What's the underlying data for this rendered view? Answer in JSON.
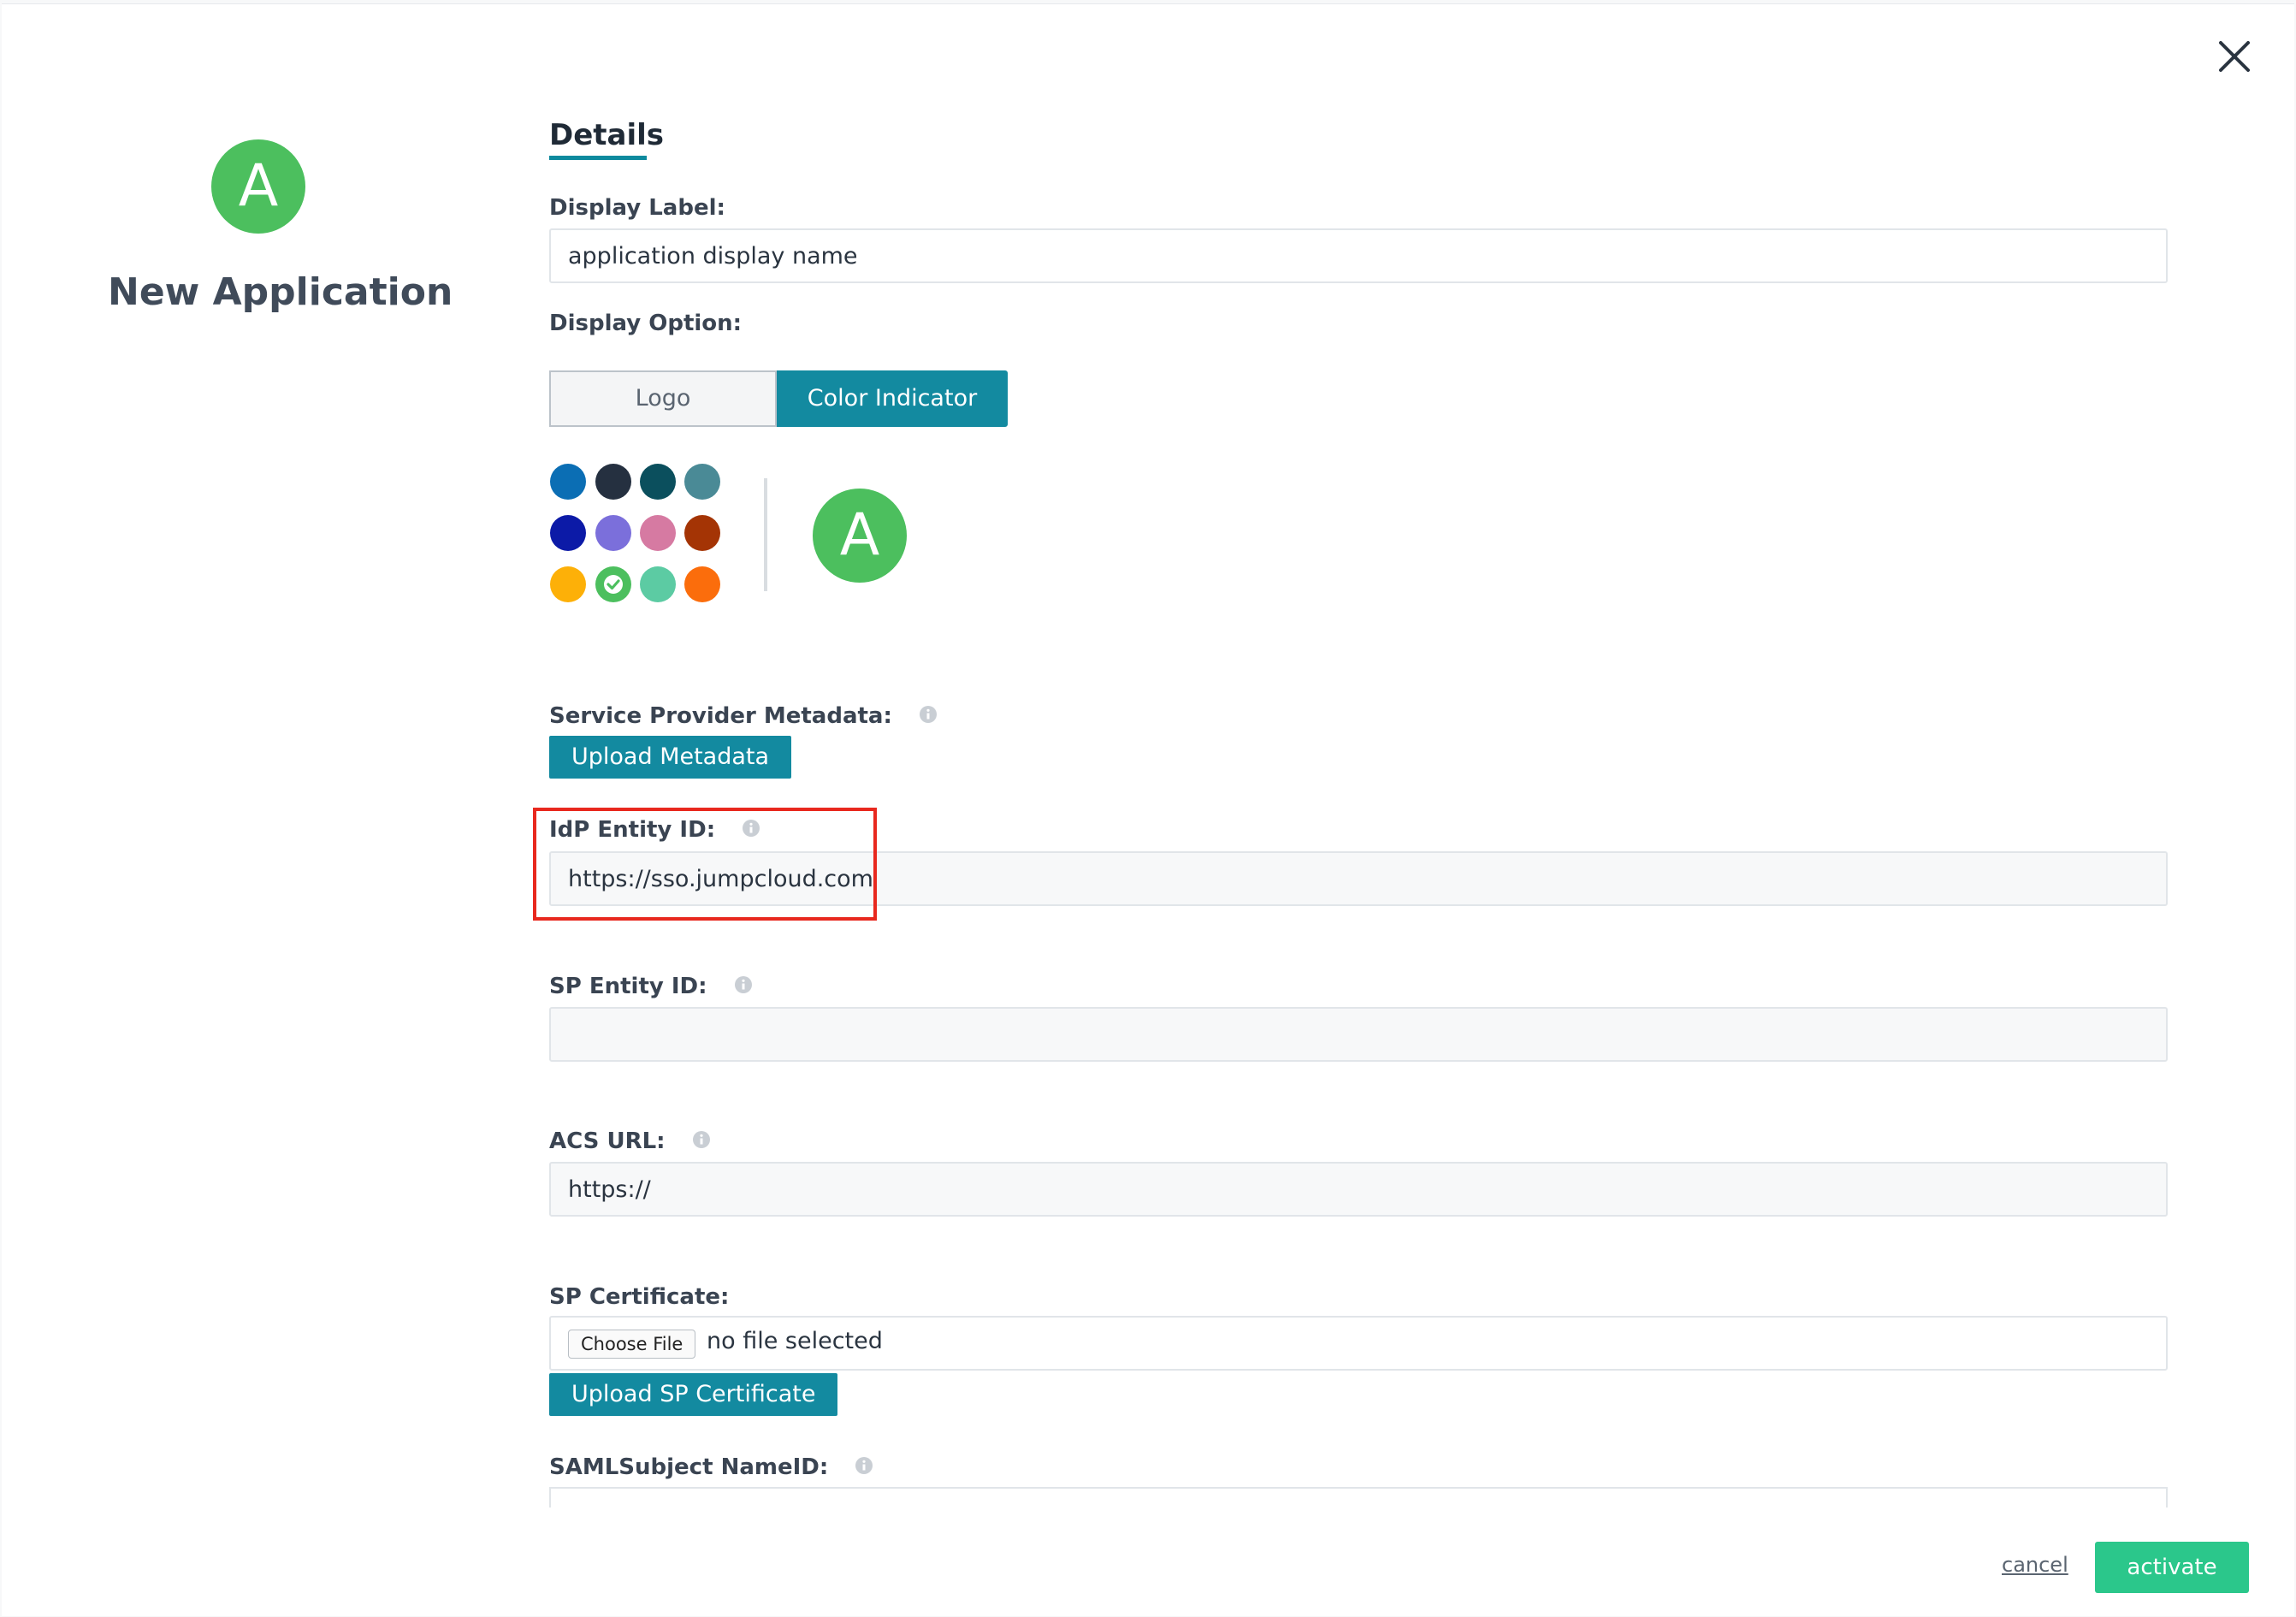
{
  "app": {
    "avatar_letter": "A",
    "title": "New Application"
  },
  "tabs": {
    "details_label": "Details"
  },
  "display_label": {
    "label": "Display Label:",
    "value": "application display name"
  },
  "display_option": {
    "label": "Display Option:",
    "options": [
      "Logo",
      "Color Indicator"
    ],
    "selected": "Color Indicator"
  },
  "color_indicator": {
    "swatches": [
      "#0b6eb4",
      "#253040",
      "#0b4f5d",
      "#4a8a96",
      "#0c1aa7",
      "#7b6fdb",
      "#d67aa2",
      "#a43405",
      "#fdb008",
      "#4cbf5e",
      "#5ccba3",
      "#fb6d0c"
    ],
    "selected_color": "#4cbf5e",
    "preview_letter": "A"
  },
  "service_provider_metadata": {
    "label": "Service Provider Metadata:",
    "upload_label": "Upload Metadata"
  },
  "idp_entity_id": {
    "label": "IdP Entity ID:",
    "value": "https://sso.jumpcloud.com"
  },
  "sp_entity_id": {
    "label": "SP Entity ID:",
    "value": ""
  },
  "acs_url": {
    "label": "ACS URL:",
    "value": "https://"
  },
  "sp_certificate": {
    "label": "SP Certificate:",
    "choose_file_label": "Choose File",
    "file_status": "no file selected",
    "upload_label": "Upload SP Certificate"
  },
  "saml_subject_nameid": {
    "label": "SAMLSubject NameID:"
  },
  "footer": {
    "cancel_label": "cancel",
    "activate_label": "activate"
  },
  "colors": {
    "accent": "#138aa0",
    "activate": "#2bc78b",
    "highlight": "#e8281e"
  }
}
